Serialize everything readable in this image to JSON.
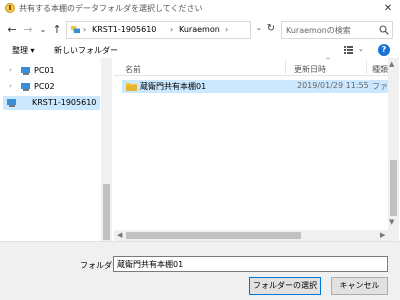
{
  "window": {
    "title": "共有する本棚のデータフォルダを選択してください",
    "close_glyph": "✕"
  },
  "nav": {
    "back_glyph": "←",
    "forward_glyph": "→",
    "recent_glyph": "⌄",
    "up_glyph": "↑",
    "refresh_glyph": "↻"
  },
  "address": {
    "crumbs": [
      "KRST1-1905610",
      "Kuraemon"
    ],
    "separators": [
      "›",
      "›",
      "›"
    ],
    "dropdown_glyph": "⌄"
  },
  "search": {
    "placeholder": "Kuraemonの検索"
  },
  "toolbar": {
    "organize_label": "整理 ▾",
    "new_folder_label": "新しいフォルダー"
  },
  "sidebar": {
    "items": [
      {
        "label": "PC01",
        "selected": false
      },
      {
        "label": "PC02",
        "selected": false
      },
      {
        "label": "KRST1-1905610",
        "selected": true
      }
    ]
  },
  "columns": {
    "name": "名前",
    "date": "更新日時",
    "type": "種類",
    "sort_glyph": "^"
  },
  "files": [
    {
      "name": "蔵衛門共有本棚01",
      "modified": "2019/01/29 11:55",
      "type": "ファイル フォルダー"
    }
  ],
  "bottom": {
    "folder_label": "フォルダー:",
    "folder_value": "蔵衛門共有本棚01",
    "select_button": "フォルダーの選択",
    "cancel_button": "キャンセル"
  },
  "colors": {
    "selection": "#cce8ff",
    "accent": "#0078d7",
    "folder": "#f4c542"
  }
}
